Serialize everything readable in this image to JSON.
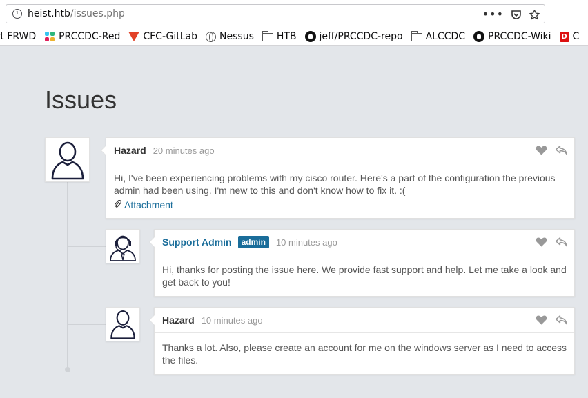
{
  "browser": {
    "url_host": "heist.htb",
    "url_path": "/issues.php",
    "bookmarks": [
      {
        "label": "ort FRWD",
        "icon": "none"
      },
      {
        "label": "PRCCDC-Red",
        "icon": "slack-icon"
      },
      {
        "label": "CFC-GitLab",
        "icon": "gitlab-icon"
      },
      {
        "label": "Nessus",
        "icon": "globe-icon"
      },
      {
        "label": "HTB",
        "icon": "folder-icon"
      },
      {
        "label": "jeff/PRCCDC-repo",
        "icon": "github-icon"
      },
      {
        "label": "ALCCDC",
        "icon": "folder-icon"
      },
      {
        "label": "PRCCDC-Wiki",
        "icon": "github-icon"
      },
      {
        "label": "C",
        "icon": "red-d-icon"
      }
    ]
  },
  "page": {
    "title": "Issues"
  },
  "posts": [
    {
      "author": "Hazard",
      "time": "20 minutes ago",
      "text": "Hi, I've been experiencing problems with my cisco router. Here's a part of the configuration the previous admin had been using. I'm new to this and don't know how to fix it. :(",
      "attachment_label": "Attachment"
    },
    {
      "author": "Support Admin",
      "badge": "admin",
      "time": "10 minutes ago",
      "text": "Hi, thanks for posting the issue here. We provide fast support and help. Let me take a look and get back to you!"
    },
    {
      "author": "Hazard",
      "time": "10 minutes ago",
      "text": "Thanks a lot. Also, please create an account for me on the windows server as I need to access the files."
    }
  ],
  "colors": {
    "background": "#e3e6ea",
    "link": "#1a6d9a",
    "badge": "#1a6d9a"
  }
}
